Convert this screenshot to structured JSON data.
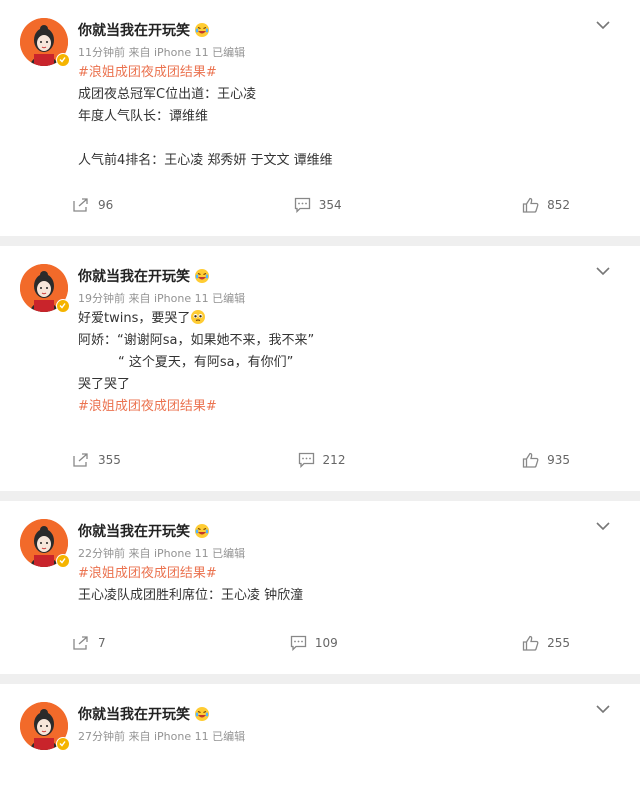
{
  "posts": [
    {
      "username": "你就当我在开玩笑",
      "time": "11分钟前",
      "source": "来自 iPhone 11",
      "edited": "已编辑",
      "lines": [
        {
          "type": "tag",
          "text": "#浪姐成团夜成团结果#"
        },
        {
          "type": "text",
          "text": "成团夜总冠军C位出道：王心凌"
        },
        {
          "type": "text",
          "text": "年度人气队长：谭维维"
        },
        {
          "type": "gap",
          "text": ""
        },
        {
          "type": "text",
          "text": "人气前4排名：王心凌 郑秀妍 于文文 谭维维"
        }
      ],
      "reposts": "96",
      "comments": "354",
      "likes": "852"
    },
    {
      "username": "你就当我在开玩笑",
      "time": "19分钟前",
      "source": "来自 iPhone 11",
      "edited": "已编辑",
      "lines": [
        {
          "type": "text",
          "text": "好爱twins，要哭了",
          "emoji": "pleading-face-icon"
        },
        {
          "type": "text",
          "text": "阿娇：“谢谢阿sa，如果她不来，我不来”"
        },
        {
          "type": "indent",
          "text": "“ 这个夏天，有阿sa，有你们”"
        },
        {
          "type": "text",
          "text": "哭了哭了"
        },
        {
          "type": "tag",
          "text": "#浪姐成团夜成团结果#"
        }
      ],
      "reposts": "355",
      "comments": "212",
      "likes": "935"
    },
    {
      "username": "你就当我在开玩笑",
      "time": "22分钟前",
      "source": "来自 iPhone 11",
      "edited": "已编辑",
      "lines": [
        {
          "type": "tag",
          "text": "#浪姐成团夜成团结果#"
        },
        {
          "type": "text",
          "text": "王心凌队成团胜利席位：王心凌 钟欣潼"
        }
      ],
      "reposts": "7",
      "comments": "109",
      "likes": "255"
    },
    {
      "username": "你就当我在开玩笑",
      "time": "27分钟前",
      "source": "来自 iPhone 11",
      "edited": "已编辑",
      "lines": [],
      "reposts": "",
      "comments": "",
      "likes": ""
    }
  ],
  "colors": {
    "topic": "#eb7350",
    "verified": "#f5b400",
    "avatar_bg": "#f26a2a"
  },
  "icons": {
    "more": "chevron-down-icon",
    "repost": "repost-icon",
    "comment": "comment-icon",
    "like": "thumbs-up-icon",
    "name_emoji": "laughing-tears-emoji-icon"
  }
}
